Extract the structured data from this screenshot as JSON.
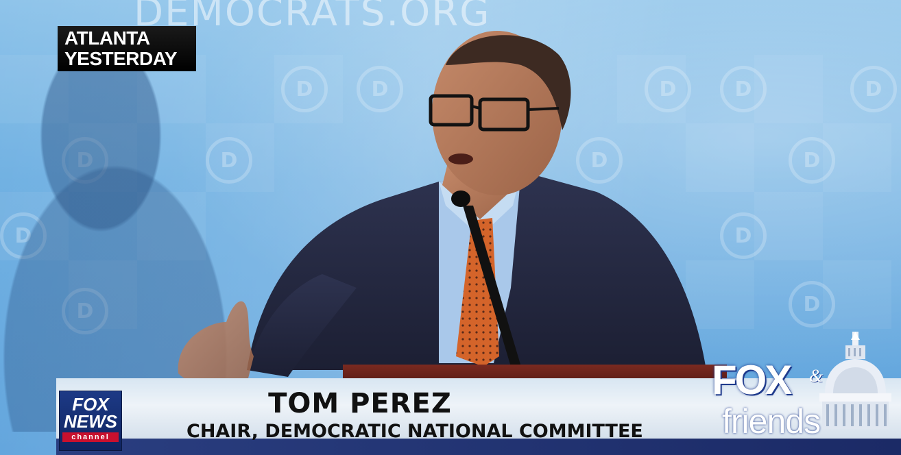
{
  "backdrop": {
    "website": "DEMOCRATS.ORG",
    "logo_glyph": "D"
  },
  "location_bug": {
    "line1": "ATLANTA",
    "line2": "YESTERDAY"
  },
  "lower_third": {
    "name": "TOM PEREZ",
    "title": "CHAIR, DEMOCRATIC NATIONAL COMMITTEE"
  },
  "network_logo": {
    "line1": "FOX",
    "line2": "NEWS",
    "line3": "channel"
  },
  "show_logo": {
    "word1": "FOX",
    "amp": "&",
    "word2": "friends"
  },
  "colors": {
    "backdrop_blue": "#6fb0e2",
    "fox_news_blue": "#1d3a86",
    "fox_red": "#c8102e",
    "tie_orange": "#d4642a",
    "suit_navy": "#262a44"
  },
  "icons": [
    "capitol-dome-icon",
    "dnc-logo-icon",
    "fox-news-logo"
  ]
}
